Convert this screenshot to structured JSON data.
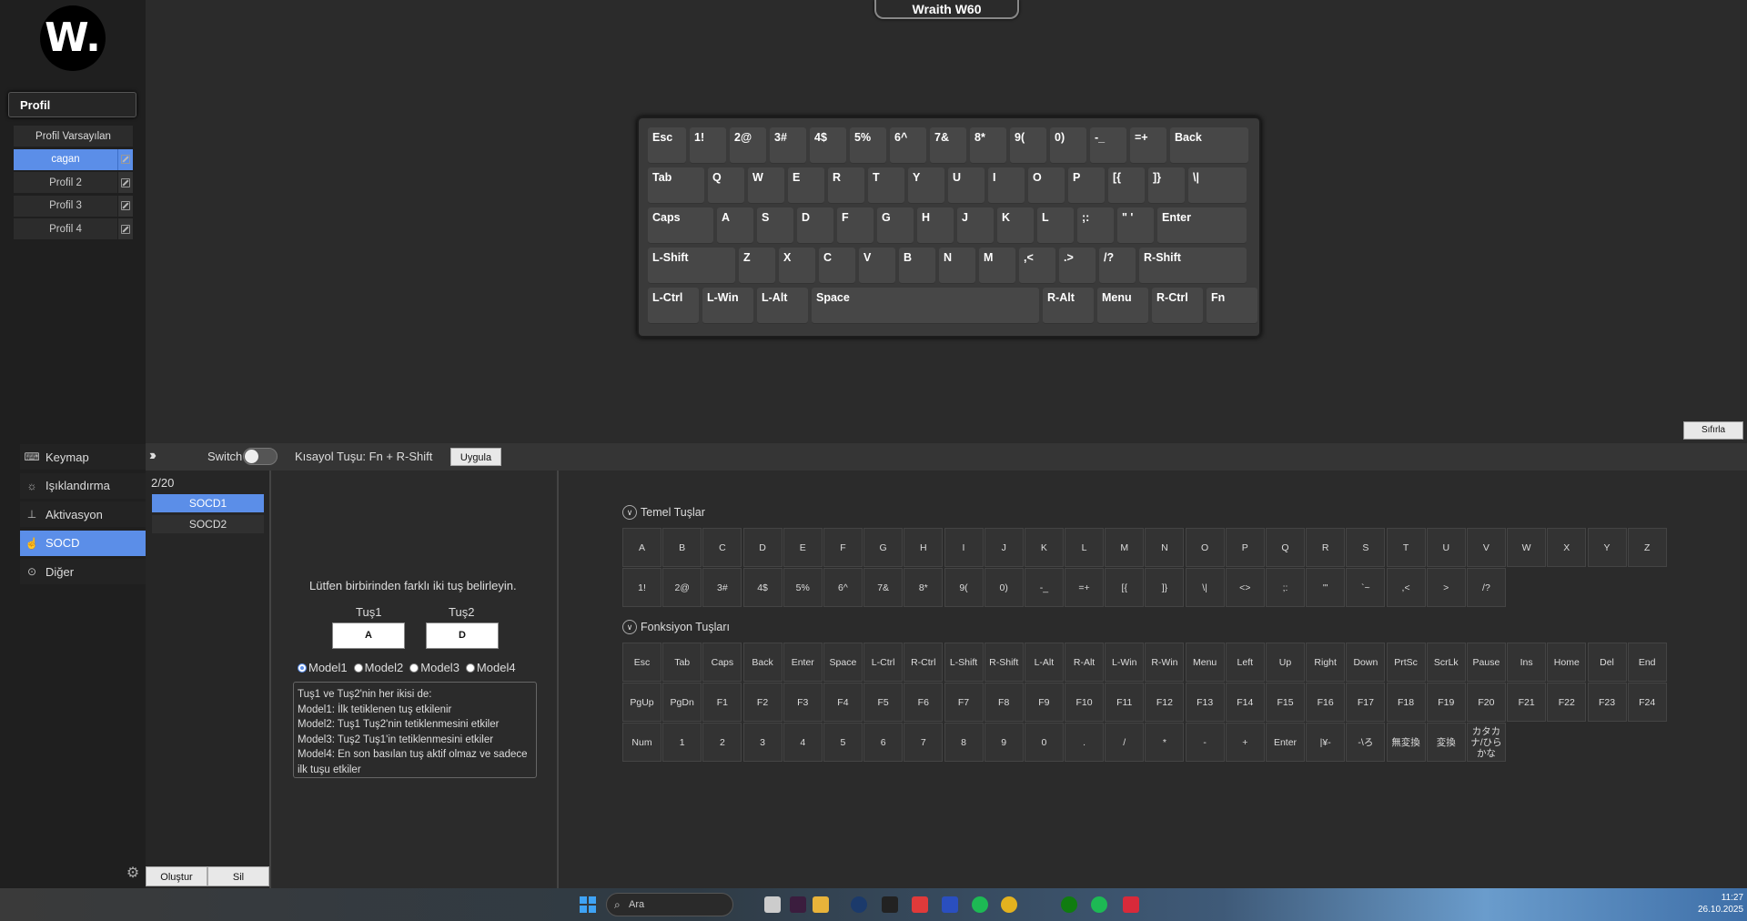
{
  "app": {
    "logo_text": "W.",
    "device_name": "Wraith W60",
    "reset_label": "Sıfırla"
  },
  "profiles": {
    "header": "Profil",
    "items": [
      {
        "label": "Profil Varsayılan"
      },
      {
        "label": "cagan"
      },
      {
        "label": "Profil 2"
      },
      {
        "label": "Profil 3"
      },
      {
        "label": "Profil 4"
      }
    ]
  },
  "nav": [
    {
      "label": "Keymap",
      "icon": "keyboard-icon"
    },
    {
      "label": "Işıklandırma",
      "icon": "sun-icon"
    },
    {
      "label": "Aktivasyon",
      "icon": "actuation-icon"
    },
    {
      "label": "SOCD",
      "icon": "hand-icon"
    },
    {
      "label": "Diğer",
      "icon": "more-icon"
    }
  ],
  "keyboard": {
    "rows": [
      [
        "Esc",
        "1!",
        "2@",
        "3#",
        "4$",
        "5%",
        "6^",
        "7&",
        "8*",
        "9(",
        "0)",
        "-_",
        "=+",
        "Back"
      ],
      [
        "Tab",
        "Q",
        "W",
        "E",
        "R",
        "T",
        "Y",
        "U",
        "I",
        "O",
        "P",
        "[{",
        "]}",
        "\\|"
      ],
      [
        "Caps",
        "A",
        "S",
        "D",
        "F",
        "G",
        "H",
        "J",
        "K",
        "L",
        ";:",
        "\" '",
        "Enter"
      ],
      [
        "L-Shift",
        "Z",
        "X",
        "C",
        "V",
        "B",
        "N",
        "M",
        ",<",
        ".>",
        "/?",
        "R-Shift"
      ],
      [
        "L-Ctrl",
        "L-Win",
        "L-Alt",
        "Space",
        "R-Alt",
        "Menu",
        "R-Ctrl",
        "Fn"
      ]
    ]
  },
  "toolbar": {
    "switch_label": "Switch",
    "shortcut_label": "Kısayol Tuşu: Fn + R-Shift",
    "apply_label": "Uygula"
  },
  "socd": {
    "count": "2/20",
    "items": [
      "SOCD1",
      "SOCD2"
    ],
    "create_label": "Oluştur",
    "delete_label": "Sil"
  },
  "config": {
    "instruction": "Lütfen birbirinden farklı iki tuş belirleyin.",
    "key1_label": "Tuş1",
    "key2_label": "Tuş2",
    "key1_value": "A",
    "key2_value": "D",
    "models": [
      "Model1",
      "Model2",
      "Model3",
      "Model4"
    ],
    "description": [
      "Tuş1 ve Tuş2'nin her ikisi de:",
      "Model1: İlk tetiklenen tuş etkilenir",
      "Model2: Tuş1 Tuş2'nin tetiklenmesini etkiler",
      "Model3: Tuş2 Tuş1'in tetiklenmesini etkiler",
      "Model4: En son basılan tuş aktif olmaz ve sadece ilk tuşu etkiler"
    ]
  },
  "basic_keys": {
    "title": "Temel Tuşlar",
    "keys": [
      "A",
      "B",
      "C",
      "D",
      "E",
      "F",
      "G",
      "H",
      "I",
      "J",
      "K",
      "L",
      "M",
      "N",
      "O",
      "P",
      "Q",
      "R",
      "S",
      "T",
      "U",
      "V",
      "W",
      "X",
      "Y",
      "Z",
      "1!",
      "2@",
      "3#",
      "4$",
      "5%",
      "6^",
      "7&",
      "8*",
      "9(",
      "0)",
      "-_",
      "=+",
      "[{",
      "]}",
      "\\|",
      "<>",
      ";:",
      "\"'",
      "`~",
      ",<",
      ">",
      "/?"
    ]
  },
  "function_keys": {
    "title": "Fonksiyon Tuşları",
    "keys": [
      "Esc",
      "Tab",
      "Caps",
      "Back",
      "Enter",
      "Space",
      "L-Ctrl",
      "R-Ctrl",
      "L-Shift",
      "R-Shift",
      "L-Alt",
      "R-Alt",
      "L-Win",
      "R-Win",
      "Menu",
      "Left",
      "Up",
      "Right",
      "Down",
      "PrtSc",
      "ScrLk",
      "Pause",
      "Ins",
      "Home",
      "Del",
      "End",
      "PgUp",
      "PgDn",
      "F1",
      "F2",
      "F3",
      "F4",
      "F5",
      "F6",
      "F7",
      "F8",
      "F9",
      "F10",
      "F11",
      "F12",
      "F13",
      "F14",
      "F15",
      "F16",
      "F17",
      "F18",
      "F19",
      "F20",
      "F21",
      "F22",
      "F23",
      "F24",
      "Num",
      "1",
      "2",
      "3",
      "4",
      "5",
      "6",
      "7",
      "8",
      "9",
      "0",
      ".",
      "/",
      "*",
      "-",
      "+",
      "Enter",
      "|¥-",
      "-\\ろ",
      "無変換",
      "変換",
      "カタカナ/ひらかな"
    ]
  },
  "taskbar": {
    "search_placeholder": "Ara",
    "time": "11:27",
    "date": "26.10.2025"
  }
}
